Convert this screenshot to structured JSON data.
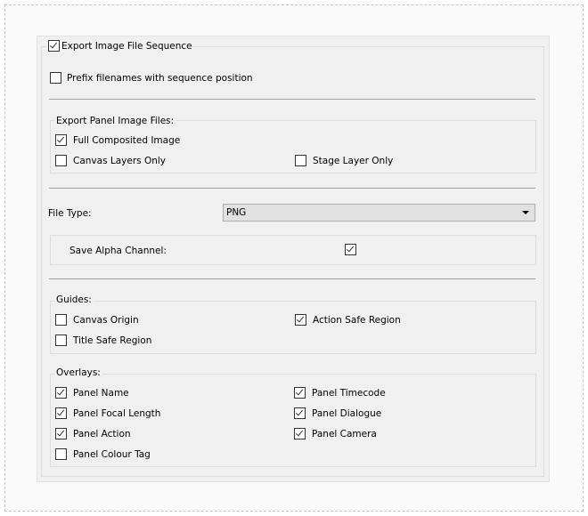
{
  "export_sequence": {
    "label": "Export Image File Sequence",
    "checked": true
  },
  "prefix": {
    "label": "Prefix filenames with sequence position",
    "checked": false
  },
  "panel_files": {
    "title": "Export Panel Image Files:",
    "items": [
      {
        "label": "Full Composited Image",
        "checked": true
      },
      {
        "label": "Canvas Layers Only",
        "checked": false
      },
      {
        "label": "Stage Layer Only",
        "checked": false
      }
    ]
  },
  "file_type": {
    "label": "File Type:",
    "value": "PNG"
  },
  "alpha": {
    "label": "Save Alpha Channel:",
    "checked": true
  },
  "guides": {
    "title": "Guides:",
    "items": [
      {
        "label": "Canvas Origin",
        "checked": false
      },
      {
        "label": "Action Safe Region",
        "checked": true
      },
      {
        "label": "Title Safe Region",
        "checked": false
      }
    ]
  },
  "overlays": {
    "title": "Overlays:",
    "items": [
      {
        "label": "Panel Name",
        "checked": true
      },
      {
        "label": "Panel Timecode",
        "checked": true
      },
      {
        "label": "Panel Focal Length",
        "checked": true
      },
      {
        "label": "Panel Dialogue",
        "checked": true
      },
      {
        "label": "Panel Action",
        "checked": true
      },
      {
        "label": "Panel Camera",
        "checked": true
      },
      {
        "label": "Panel Colour Tag",
        "checked": false
      }
    ]
  }
}
